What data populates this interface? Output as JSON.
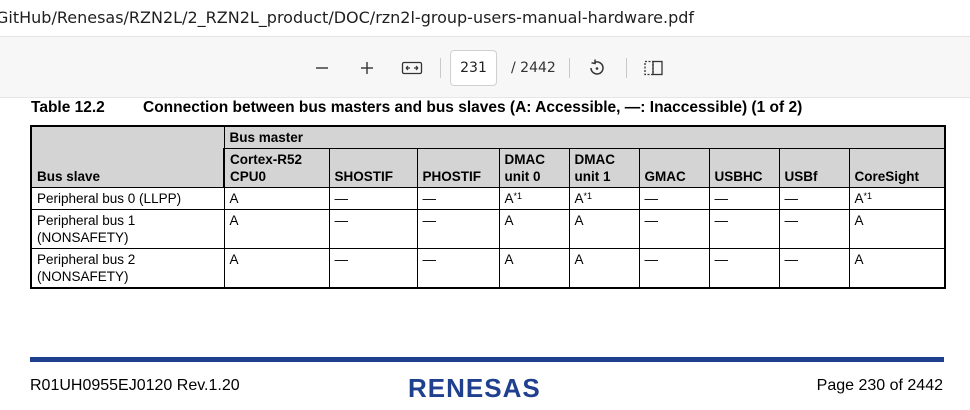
{
  "window": {
    "title_path": "GitHub/Renesas/RZN2L/2_RZN2L_product/DOC/rzn2l-group-users-manual-hardware.pdf"
  },
  "toolbar": {
    "zoom_out_icon": "minus-icon",
    "zoom_in_icon": "plus-icon",
    "fit_icon": "fit-width-icon",
    "current_page": "231",
    "total_pages": "/ 2442",
    "rotate_icon": "rotate-icon",
    "two_page_icon": "two-page-view-icon"
  },
  "table": {
    "number": "Table 12.2",
    "title": "Connection between bus masters and bus slaves (A: Accessible, —: Inaccessible) (1 of 2)",
    "group_header": "Bus master",
    "slave_header": "Bus slave",
    "columns": [
      "Cortex-R52\nCPU0",
      "SHOSTIF",
      "PHOSTIF",
      "DMAC\nunit 0",
      "DMAC\nunit 1",
      "GMAC",
      "USBHC",
      "USBf",
      "CoreSight"
    ],
    "rows": [
      {
        "slave": "Peripheral bus 0 (LLPP)",
        "cells": [
          "A",
          "—",
          "—",
          "A",
          "A",
          "—",
          "—",
          "—",
          "A"
        ],
        "notes": [
          "",
          "",
          "",
          "*1",
          "*1",
          "",
          "",
          "",
          "*1"
        ]
      },
      {
        "slave": "Peripheral bus 1\n(NONSAFETY)",
        "cells": [
          "A",
          "—",
          "—",
          "A",
          "A",
          "—",
          "—",
          "—",
          "A"
        ],
        "notes": [
          "",
          "",
          "",
          "",
          "",
          "",
          "",
          "",
          ""
        ]
      },
      {
        "slave": "Peripheral bus 2\n(NONSAFETY)",
        "cells": [
          "A",
          "—",
          "—",
          "A",
          "A",
          "—",
          "—",
          "—",
          "A"
        ],
        "notes": [
          "",
          "",
          "",
          "",
          "",
          "",
          "",
          "",
          ""
        ]
      }
    ]
  },
  "footer": {
    "doc_id": "R01UH0955EJ0120  Rev.1.20",
    "logo_text": "RENESAS",
    "page_label": "Page 230 of 2442",
    "accent_color": "#1f3f8f"
  }
}
